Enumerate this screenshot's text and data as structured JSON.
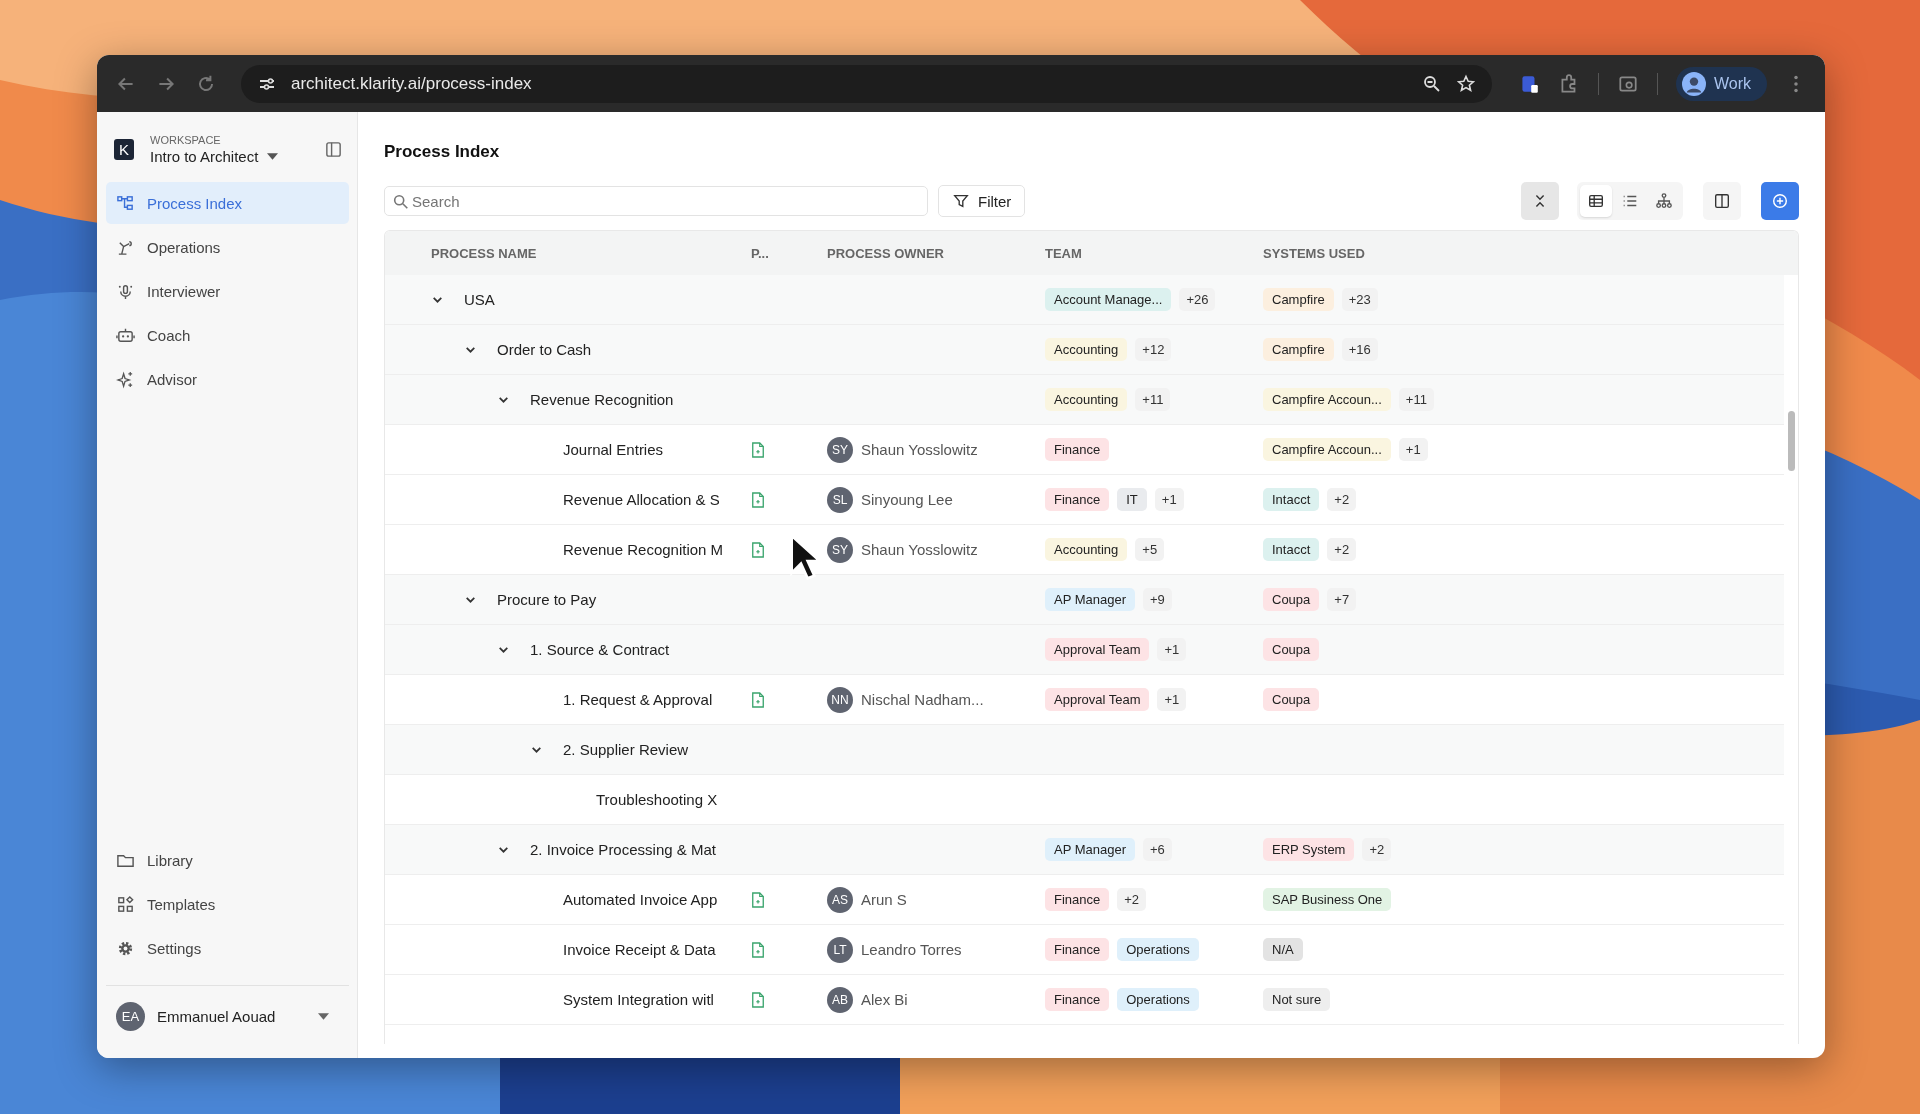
{
  "browser": {
    "url": "architect.klarity.ai/process-index",
    "profile": "Work"
  },
  "sidebar": {
    "logo": "K",
    "workspace_label": "WORKSPACE",
    "workspace": "Intro to Architect",
    "items": [
      {
        "label": "Process Index",
        "selected": true
      },
      {
        "label": "Operations",
        "selected": false
      },
      {
        "label": "Interviewer",
        "selected": false
      },
      {
        "label": "Coach",
        "selected": false
      },
      {
        "label": "Advisor",
        "selected": false
      }
    ],
    "bottom_items": [
      {
        "label": "Library"
      },
      {
        "label": "Templates"
      },
      {
        "label": "Settings"
      }
    ],
    "user": {
      "initials": "EA",
      "name": "Emmanuel Aouad"
    }
  },
  "page": {
    "title": "Process Index",
    "search": {
      "placeholder": "Search"
    },
    "filter": "Filter",
    "views": [
      {
        "kind": "table",
        "selected": true
      },
      {
        "kind": "list",
        "selected": false
      },
      {
        "kind": "tree",
        "selected": false
      }
    ]
  },
  "table": {
    "columns": [
      "PROCESS NAME",
      "P...",
      "PROCESS OWNER",
      "TEAM",
      "SYSTEMS USED"
    ],
    "rows": [
      {
        "name": "USA",
        "expanded": true,
        "team": [
          {
            "label": "Account Manage...",
            "color": "#dcf1ef"
          }
        ],
        "team_more": "+26",
        "systems": [
          {
            "label": "Campfire",
            "color": "#fcefdf"
          }
        ],
        "systems_more": "+23",
        "children": [
          {
            "name": "Order to Cash",
            "expanded": true,
            "team": [
              {
                "label": "Accounting",
                "color": "#faf5e0"
              }
            ],
            "team_more": "+12",
            "systems": [
              {
                "label": "Campfire",
                "color": "#fcefdf"
              }
            ],
            "systems_more": "+16",
            "children": [
              {
                "name": "Revenue Recognition",
                "expanded": true,
                "team": [
                  {
                    "label": "Accounting",
                    "color": "#faf5e0"
                  }
                ],
                "team_more": "+11",
                "systems": [
                  {
                    "label": "Campfire Accoun...",
                    "color": "#faf5e0"
                  }
                ],
                "systems_more": "+11",
                "children": [
                  {
                    "name": "Journal Entries",
                    "document": true,
                    "owner": {
                      "initials": "SY",
                      "name": "Shaun Yosslowitz"
                    },
                    "team": [
                      {
                        "label": "Finance",
                        "color": "#fde3e5"
                      }
                    ],
                    "systems": [
                      {
                        "label": "Campfire Accoun...",
                        "color": "#faf5e0"
                      }
                    ],
                    "systems_more": "+1"
                  },
                  {
                    "name": "Revenue Allocation & S",
                    "document": true,
                    "owner": {
                      "initials": "SL",
                      "name": "Sinyoung Lee"
                    },
                    "team": [
                      {
                        "label": "Finance",
                        "color": "#fde3e5"
                      },
                      {
                        "label": "IT",
                        "color": "#e9ebee"
                      }
                    ],
                    "team_more": "+1",
                    "systems": [
                      {
                        "label": "Intacct",
                        "color": "#dcf1ef"
                      }
                    ],
                    "systems_more": "+2"
                  },
                  {
                    "name": "Revenue Recognition M",
                    "document": true,
                    "owner": {
                      "initials": "SY",
                      "name": "Shaun Yosslowitz"
                    },
                    "team": [
                      {
                        "label": "Accounting",
                        "color": "#faf5e0"
                      }
                    ],
                    "team_more": "+5",
                    "systems": [
                      {
                        "label": "Intacct",
                        "color": "#dcf1ef"
                      }
                    ],
                    "systems_more": "+2"
                  }
                ]
              }
            ]
          },
          {
            "name": "Procure to Pay",
            "expanded": true,
            "team": [
              {
                "label": "AP Manager",
                "color": "#dff0fb"
              }
            ],
            "team_more": "+9",
            "systems": [
              {
                "label": "Coupa",
                "color": "#fde3e5"
              }
            ],
            "systems_more": "+7",
            "children": [
              {
                "name": "1. Source & Contract",
                "expanded": true,
                "team": [
                  {
                    "label": "Approval Team",
                    "color": "#fde3e5"
                  }
                ],
                "team_more": "+1",
                "systems": [
                  {
                    "label": "Coupa",
                    "color": "#fde3e5"
                  }
                ],
                "children": [
                  {
                    "name": "1. Request & Approval",
                    "document": true,
                    "owner": {
                      "initials": "NN",
                      "name": "Nischal Nadham..."
                    },
                    "team": [
                      {
                        "label": "Approval Team",
                        "color": "#fde3e5"
                      }
                    ],
                    "team_more": "+1",
                    "systems": [
                      {
                        "label": "Coupa",
                        "color": "#fde3e5"
                      }
                    ]
                  },
                  {
                    "name": "2. Supplier Review",
                    "expanded": true,
                    "children": [
                      {
                        "name": "Troubleshooting X",
                        "document": false
                      }
                    ]
                  }
                ]
              },
              {
                "name": "2. Invoice Processing & Mat",
                "expanded": true,
                "team": [
                  {
                    "label": "AP Manager",
                    "color": "#dff0fb"
                  }
                ],
                "team_more": "+6",
                "systems": [
                  {
                    "label": "ERP System",
                    "color": "#fde3e5"
                  }
                ],
                "systems_more": "+2",
                "children": [
                  {
                    "name": "Automated Invoice App",
                    "document": true,
                    "owner": {
                      "initials": "AS",
                      "name": "Arun S"
                    },
                    "team": [
                      {
                        "label": "Finance",
                        "color": "#fde3e5"
                      }
                    ],
                    "team_more": "+2",
                    "systems": [
                      {
                        "label": "SAP Business One",
                        "color": "#e2f3e4"
                      }
                    ]
                  },
                  {
                    "name": "Invoice Receipt & Data",
                    "document": true,
                    "owner": {
                      "initials": "LT",
                      "name": "Leandro Torres"
                    },
                    "team": [
                      {
                        "label": "Finance",
                        "color": "#fde3e5"
                      },
                      {
                        "label": "Operations",
                        "color": "#dff0fb"
                      }
                    ],
                    "systems": [
                      {
                        "label": "N/A",
                        "color": "#e3e3e3"
                      }
                    ]
                  },
                  {
                    "name": "System Integration witl",
                    "document": true,
                    "owner": {
                      "initials": "AB",
                      "name": "Alex Bi"
                    },
                    "team": [
                      {
                        "label": "Finance",
                        "color": "#fde3e5"
                      },
                      {
                        "label": "Operations",
                        "color": "#dff0fb"
                      }
                    ],
                    "systems": [
                      {
                        "label": "Not sure",
                        "color": "#eeeeee"
                      }
                    ]
                  }
                ]
              }
            ]
          }
        ]
      }
    ]
  }
}
